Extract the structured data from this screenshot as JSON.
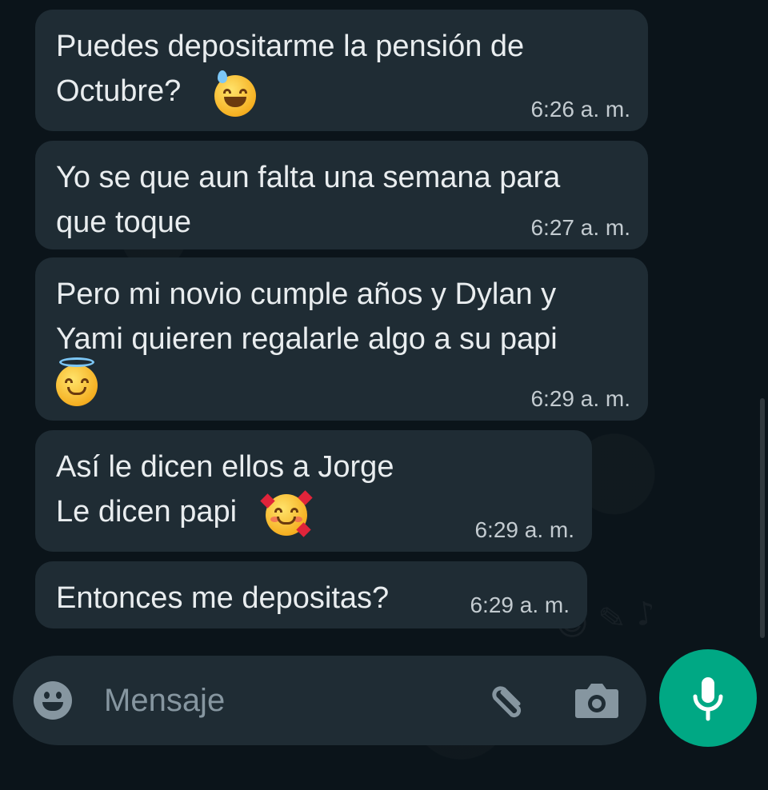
{
  "messages": [
    {
      "text": "Puedes depositarme la pensión de\nOctubre?",
      "emoji": "grinning-sweat-emoji",
      "time": "6:26 a. m."
    },
    {
      "text": "Yo se que aun falta una semana para\nque toque",
      "emoji": "",
      "time": "6:27 a. m."
    },
    {
      "text": "Pero mi novio cumple años y Dylan y\nYami quieren regalarle algo a su papi",
      "emoji": "smiling-halo-emoji",
      "time": "6:29 a. m."
    },
    {
      "text": "Así le dicen ellos a Jorge\nLe dicen papi",
      "emoji": "smiling-hearts-emoji",
      "time": "6:29 a. m."
    },
    {
      "text": "Entonces me depositas?",
      "emoji": "",
      "time": "6:29 a. m."
    }
  ],
  "composer": {
    "placeholder": "Mensaje",
    "left_icon": "emoji-icon",
    "attach_icon": "paperclip-icon",
    "camera_icon": "camera-icon"
  },
  "mic_button": {
    "icon": "microphone-icon",
    "color": "#00a884"
  },
  "colors": {
    "background": "#0b141a",
    "bubble": "#1f2c34",
    "text": "#e9edef",
    "meta": "#c3cbd0"
  }
}
